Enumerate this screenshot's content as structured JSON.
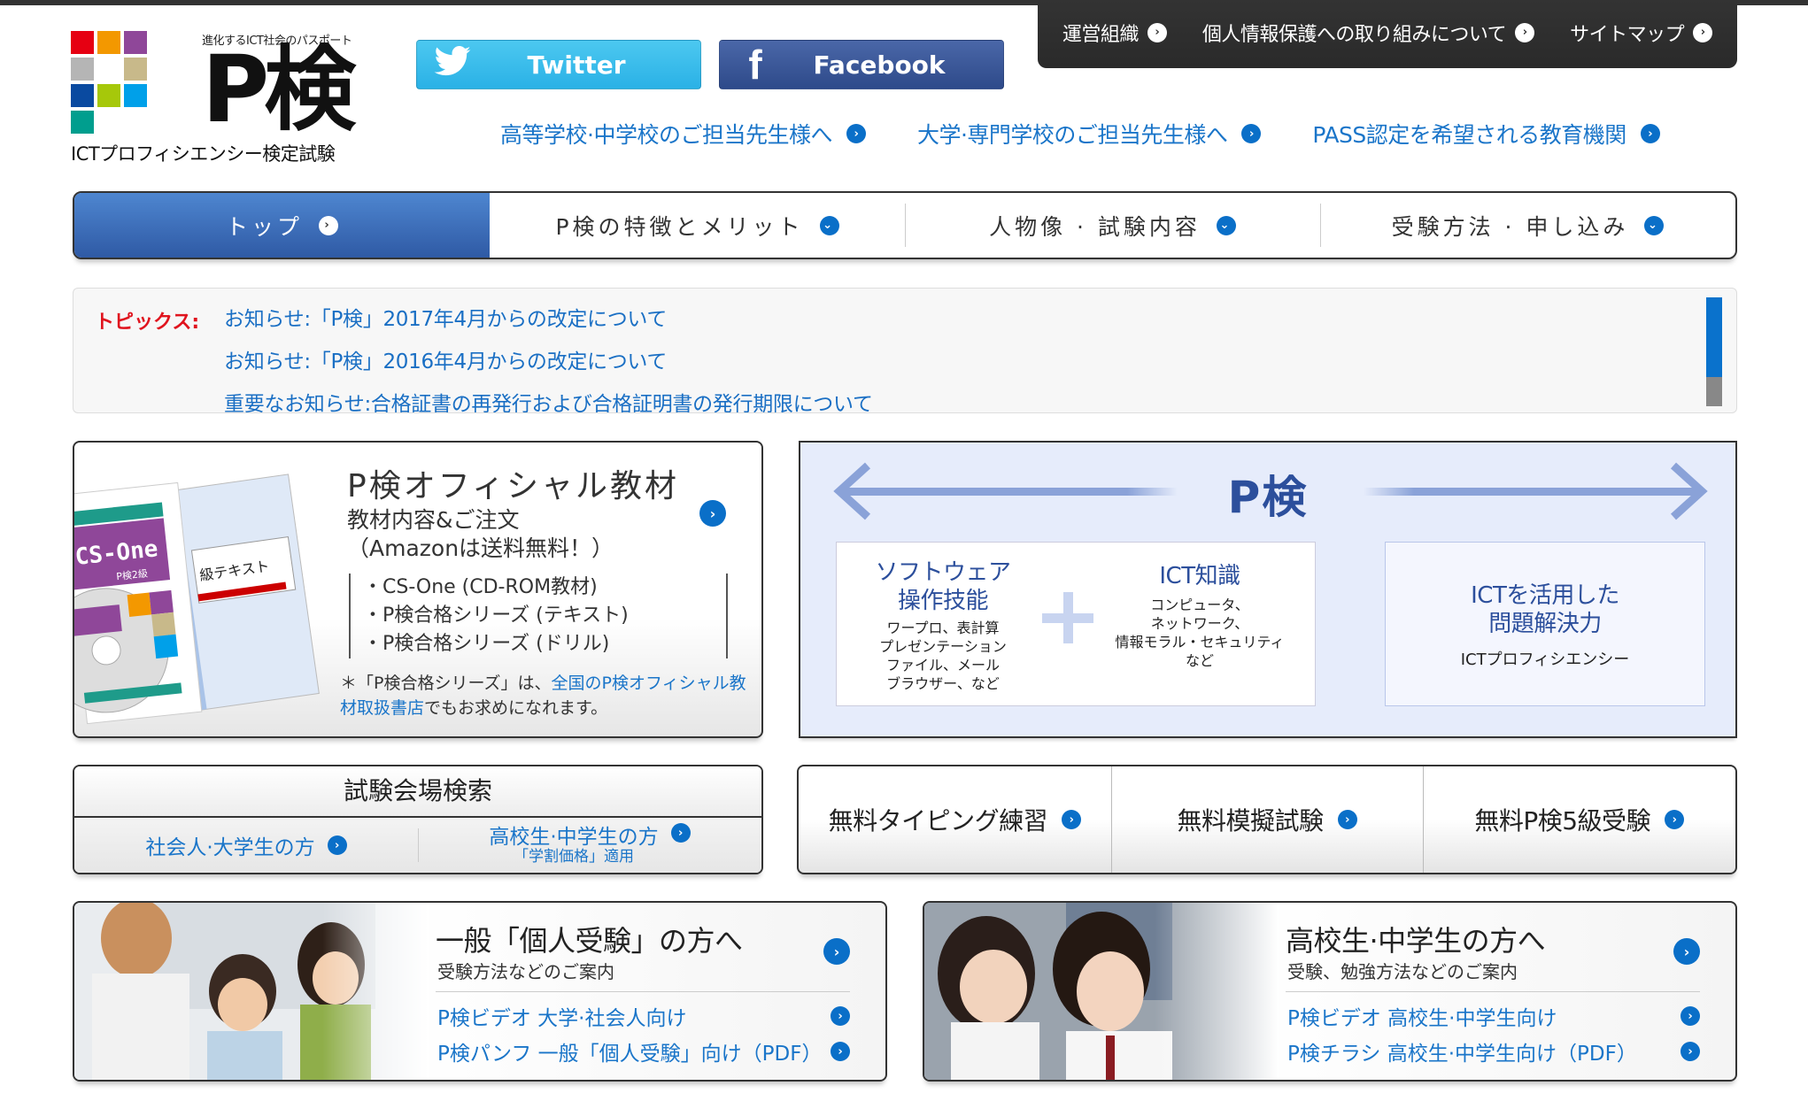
{
  "logo": {
    "tagline": "進化するICT社会のパスポート",
    "mark": "P検",
    "subtitle": "ICTプロフィシエンシー検定試験",
    "colors": [
      "#e60012",
      "#f39800",
      "#8f4799",
      "#b5b5b5",
      "#ffffff",
      "#c8b98a",
      "#0a4aa0",
      "#a6c80a",
      "#00a0e9",
      "#009e8e"
    ]
  },
  "social": {
    "twitter_label": "Twitter",
    "facebook_label": "Facebook",
    "twitter_color": "#2ab1e6",
    "facebook_color": "#3b5998"
  },
  "utility_nav": {
    "items": [
      {
        "label": "運営組織"
      },
      {
        "label": "個人情報保護への取り組みについて"
      },
      {
        "label": "サイトマップ"
      }
    ]
  },
  "audience_links": [
    {
      "label": "高等学校·中学校のご担当先生様へ"
    },
    {
      "label": "大学·専門学校のご担当先生様へ"
    },
    {
      "label": "PASS認定を希望される教育機関"
    }
  ],
  "global_nav": {
    "items": [
      {
        "label": "トップ",
        "active": true,
        "icon": "chevron-right-icon"
      },
      {
        "label": "P検の特徴とメリット",
        "icon": "chevron-down-icon"
      },
      {
        "label": "人物像 · 試験内容",
        "icon": "chevron-down-icon"
      },
      {
        "label": "受験方法 · 申し込み",
        "icon": "chevron-down-icon"
      }
    ]
  },
  "topics": {
    "label": "トピックス:",
    "items": [
      "お知らせ:「P検」2017年4月からの改定について",
      "お知らせ:「P検」2016年4月からの改定について",
      "重要なお知らせ:合格証書の再発行および合格証明書の発行期限について"
    ]
  },
  "materials": {
    "title": "P検オフィシャル教材",
    "subtitle_line1": "教材内容&ご注文",
    "subtitle_line2": "（Amazonは送料無料！）",
    "list": [
      "・CS-One (CD-ROM教材)",
      "・P検合格シリーズ (テキスト)",
      "・P検合格シリーズ (ドリル)"
    ],
    "note_prefix": "＊「P検合格シリーズ」は、",
    "note_link": "全国のP検オフィシャル教材取扱書店",
    "note_suffix": "でもお求めになれます。",
    "image_text": {
      "product": "CS-One",
      "grade": "P検2級",
      "book": "級テキスト"
    }
  },
  "diagram": {
    "title": "P検",
    "left_heading": "ソフトウェア\n操作技能",
    "left_details": "ワープロ、表計算\nプレゼンテーション\nファイル、メール\nブラウザー、など",
    "mid_heading": "ICT知識",
    "mid_details": "コンピュータ、\nネットワーク、\n情報モラル・セキュリティ\nなど",
    "right_heading": "ICTを活用した\n問題解決力",
    "right_sub": "ICTプロフィシエンシー"
  },
  "venue_search": {
    "title": "試験会場検索",
    "links": [
      {
        "label": "社会人·大学生の方"
      },
      {
        "label": "高校生·中学生の方",
        "note": "「学割価格」適用"
      }
    ]
  },
  "free_tools": [
    {
      "label": "無料タイピング練習"
    },
    {
      "label": "無料模擬試験"
    },
    {
      "label": "無料P検5級受験"
    }
  ],
  "cards": [
    {
      "title": "一般「個人受験」の方へ",
      "subtitle": "受験方法などのご案内",
      "links": [
        "P検ビデオ 大学·社会人向け",
        "P検パンフ 一般「個人受験」向け（PDF）"
      ]
    },
    {
      "title": "高校生·中学生の方へ",
      "subtitle": "受験、勉強方法などのご案内",
      "links": [
        "P検ビデオ 高校生·中学生向け",
        "P検チラシ 高校生·中学生向け（PDF）"
      ]
    }
  ],
  "accent_colors": {
    "link_blue": "#1a75c9",
    "nav_active": "#3a66b4",
    "topics_red": "#e0141e",
    "diagram_blue": "#2c4f9c"
  }
}
